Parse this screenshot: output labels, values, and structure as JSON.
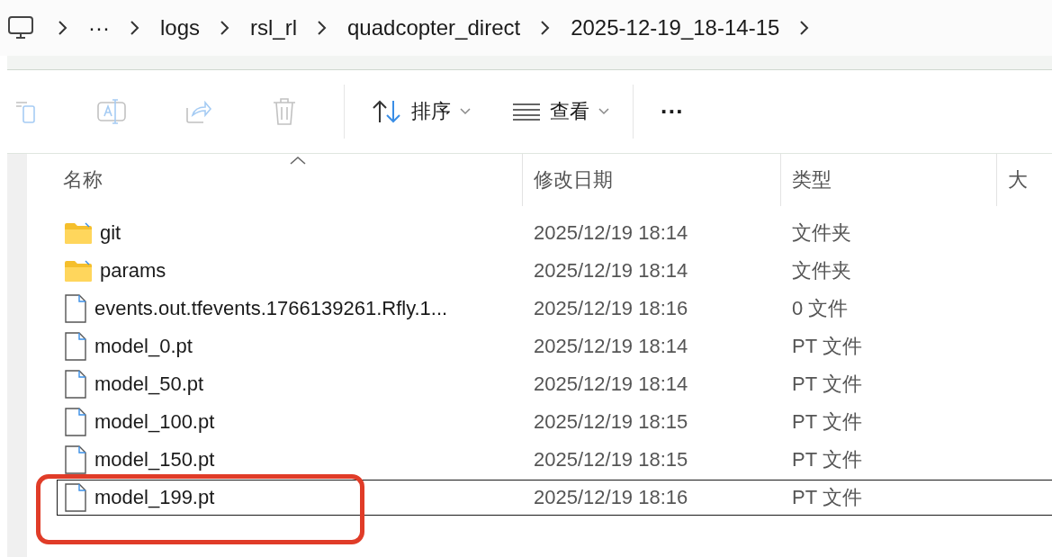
{
  "breadcrumb": [
    "···",
    "logs",
    "rsl_rl",
    "quadcopter_direct",
    "2025-12-19_18-14-15"
  ],
  "toolbar": {
    "icon_buttons": [
      {
        "kind": "copy",
        "disabled": true
      },
      {
        "kind": "rename",
        "disabled": true
      },
      {
        "kind": "share",
        "disabled": true
      },
      {
        "kind": "delete",
        "disabled": true
      }
    ],
    "sort_label": "排序",
    "view_label": "查看",
    "more": "···"
  },
  "columns": [
    {
      "label": "名称",
      "sorted": true
    },
    {
      "label": "修改日期",
      "sorted": false
    },
    {
      "label": "类型",
      "sorted": false
    },
    {
      "label": "大",
      "sorted": false
    }
  ],
  "rows": [
    {
      "kind": "folder",
      "name": "git",
      "modified": "2025/12/19 18:14",
      "type": "文件夹",
      "selected": false
    },
    {
      "kind": "folder",
      "name": "params",
      "modified": "2025/12/19 18:14",
      "type": "文件夹",
      "selected": false
    },
    {
      "kind": "file",
      "name": "events.out.tfevents.1766139261.Rfly.1...",
      "modified": "2025/12/19 18:16",
      "type": "0 文件",
      "selected": false
    },
    {
      "kind": "file",
      "name": "model_0.pt",
      "modified": "2025/12/19 18:14",
      "type": "PT 文件",
      "selected": false
    },
    {
      "kind": "file",
      "name": "model_50.pt",
      "modified": "2025/12/19 18:14",
      "type": "PT 文件",
      "selected": false
    },
    {
      "kind": "file",
      "name": "model_100.pt",
      "modified": "2025/12/19 18:15",
      "type": "PT 文件",
      "selected": false
    },
    {
      "kind": "file",
      "name": "model_150.pt",
      "modified": "2025/12/19 18:15",
      "type": "PT 文件",
      "selected": false
    },
    {
      "kind": "file",
      "name": "model_199.pt",
      "modified": "2025/12/19 18:16",
      "type": "PT 文件",
      "selected": true
    }
  ]
}
